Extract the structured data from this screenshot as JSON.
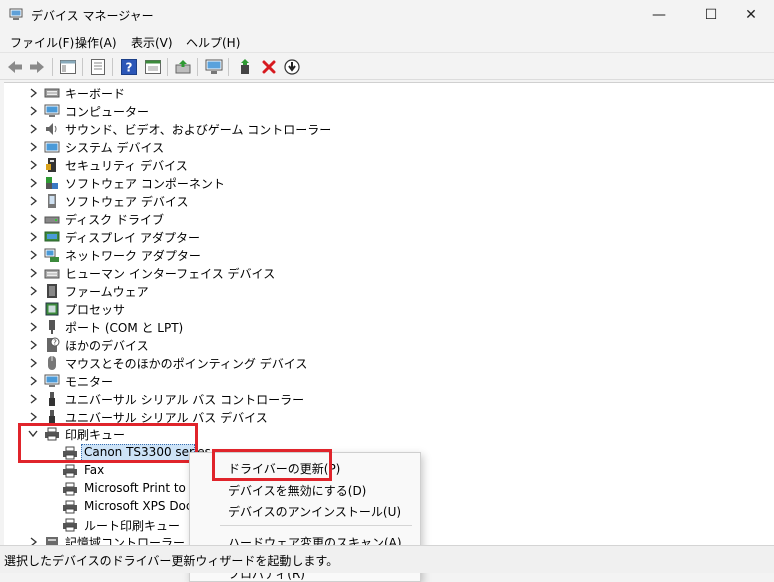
{
  "window": {
    "title": "デバイス マネージャー",
    "minimize": "—",
    "maximize": "☐",
    "close": "✕"
  },
  "menu": [
    "ファイル(F)",
    "操作(A)",
    "表示(V)",
    "ヘルプ(H)"
  ],
  "toolbar": [
    "back-icon",
    "forward-icon",
    "show-hide-tree-icon",
    "properties-icon",
    "help-icon",
    "view-icon",
    "update-driver-icon",
    "scan-hardware-icon",
    "add-driver-icon",
    "uninstall-icon",
    "disable-icon"
  ],
  "tree": {
    "categories": [
      {
        "label": "キーボード",
        "icon": "keyboard-icon"
      },
      {
        "label": "コンピューター",
        "icon": "computer-icon"
      },
      {
        "label": "サウンド、ビデオ、およびゲーム コントローラー",
        "icon": "speaker-icon"
      },
      {
        "label": "システム デバイス",
        "icon": "system-device-icon"
      },
      {
        "label": "セキュリティ デバイス",
        "icon": "security-icon"
      },
      {
        "label": "ソフトウェア コンポーネント",
        "icon": "software-component-icon"
      },
      {
        "label": "ソフトウェア デバイス",
        "icon": "software-device-icon"
      },
      {
        "label": "ディスク ドライブ",
        "icon": "disk-drive-icon"
      },
      {
        "label": "ディスプレイ アダプター",
        "icon": "display-adapter-icon"
      },
      {
        "label": "ネットワーク アダプター",
        "icon": "network-adapter-icon"
      },
      {
        "label": "ヒューマン インターフェイス デバイス",
        "icon": "hid-icon"
      },
      {
        "label": "ファームウェア",
        "icon": "firmware-icon"
      },
      {
        "label": "プロセッサ",
        "icon": "processor-icon"
      },
      {
        "label": "ポート (COM と LPT)",
        "icon": "port-icon"
      },
      {
        "label": "ほかのデバイス",
        "icon": "other-device-icon"
      },
      {
        "label": "マウスとそのほかのポインティング デバイス",
        "icon": "mouse-icon"
      },
      {
        "label": "モニター",
        "icon": "monitor-icon"
      },
      {
        "label": "ユニバーサル シリアル バス コントローラー",
        "icon": "usb-icon"
      },
      {
        "label": "ユニバーサル シリアル バス デバイス",
        "icon": "usb-icon"
      }
    ],
    "expanded": {
      "label": "印刷キュー",
      "icon": "printer-icon",
      "children": [
        "Canon TS3300 series",
        "Fax",
        "Microsoft Print to P",
        "Microsoft XPS Docu",
        "ルート印刷キュー"
      ]
    },
    "next_partial": "記憶域コントローラー"
  },
  "context_menu": {
    "items": [
      "ドライバーの更新(P)",
      "デバイスを無効にする(D)",
      "デバイスのアンインストール(U)",
      "ハードウェア変更のスキャン(A)",
      "プロパティ(R)"
    ]
  },
  "status": {
    "text": "選択したデバイスのドライバー更新ウィザードを起動します。"
  },
  "colors": {
    "highlight_box": "#e0242b",
    "selection": "#cde3f7",
    "background": "#f3f3f3"
  }
}
